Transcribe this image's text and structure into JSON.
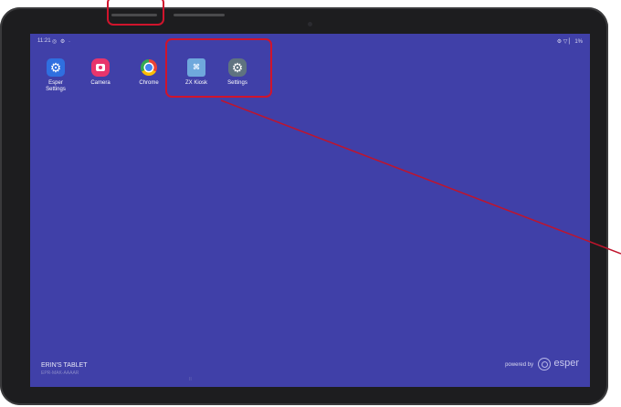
{
  "status_bar": {
    "time": "11:21",
    "left_icons": "◎ ⚙ ·",
    "right_icons": "⚙ ▽ ▏ 1%"
  },
  "apps": [
    {
      "label": "Esper\nSettings",
      "icon": "gear-icon"
    },
    {
      "label": "Camera",
      "icon": "camera-icon"
    },
    {
      "label": "Chrome",
      "icon": "chrome-icon"
    },
    {
      "label": "ZX Kiosk",
      "icon": "zx-kiosk-icon"
    },
    {
      "label": "Settings",
      "icon": "settings-gear-icon"
    }
  ],
  "device_info": {
    "name": "ERIN'S TABLET",
    "id": "EPR-MAK-AAAAR"
  },
  "nav_indicator": "II",
  "footer": {
    "powered_by": "powered by",
    "brand": "esper"
  },
  "colors": {
    "screen_background": "#4040a8",
    "device_bezel": "#1d1d1f",
    "highlight": "#d0142c",
    "annotation_line": "#c0142c"
  }
}
